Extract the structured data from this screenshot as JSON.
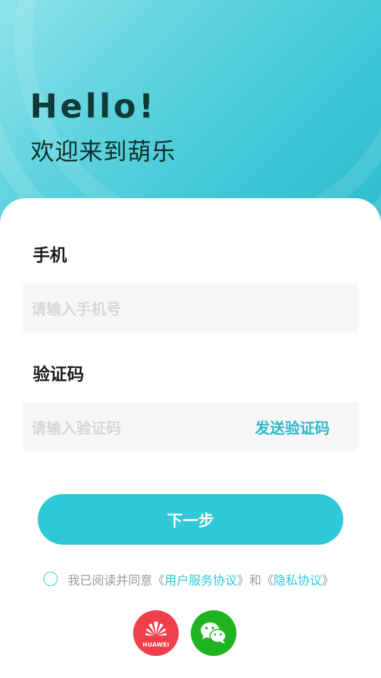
{
  "header": {
    "hello": "Hello!",
    "welcome": "欢迎来到葫乐"
  },
  "form": {
    "phone_label": "手机",
    "phone_placeholder": "请输入手机号",
    "code_label": "验证码",
    "code_placeholder": "请输入验证码",
    "send_code": "发送验证码"
  },
  "actions": {
    "next": "下一步"
  },
  "agreement": {
    "prefix": "我已阅读并同意《",
    "user_agreement": "用户服务协议",
    "middle": "》和《",
    "privacy_policy": "隐私协议",
    "suffix": "》",
    "checked": false
  },
  "social_login": {
    "huawei_text": "HUAWEI",
    "huawei_icon": "huawei-logo",
    "wechat_icon": "wechat-logo"
  },
  "colors": {
    "accent": "#2ec8d6",
    "huawei": "#ee3f4b",
    "wechat": "#1fb31f"
  }
}
